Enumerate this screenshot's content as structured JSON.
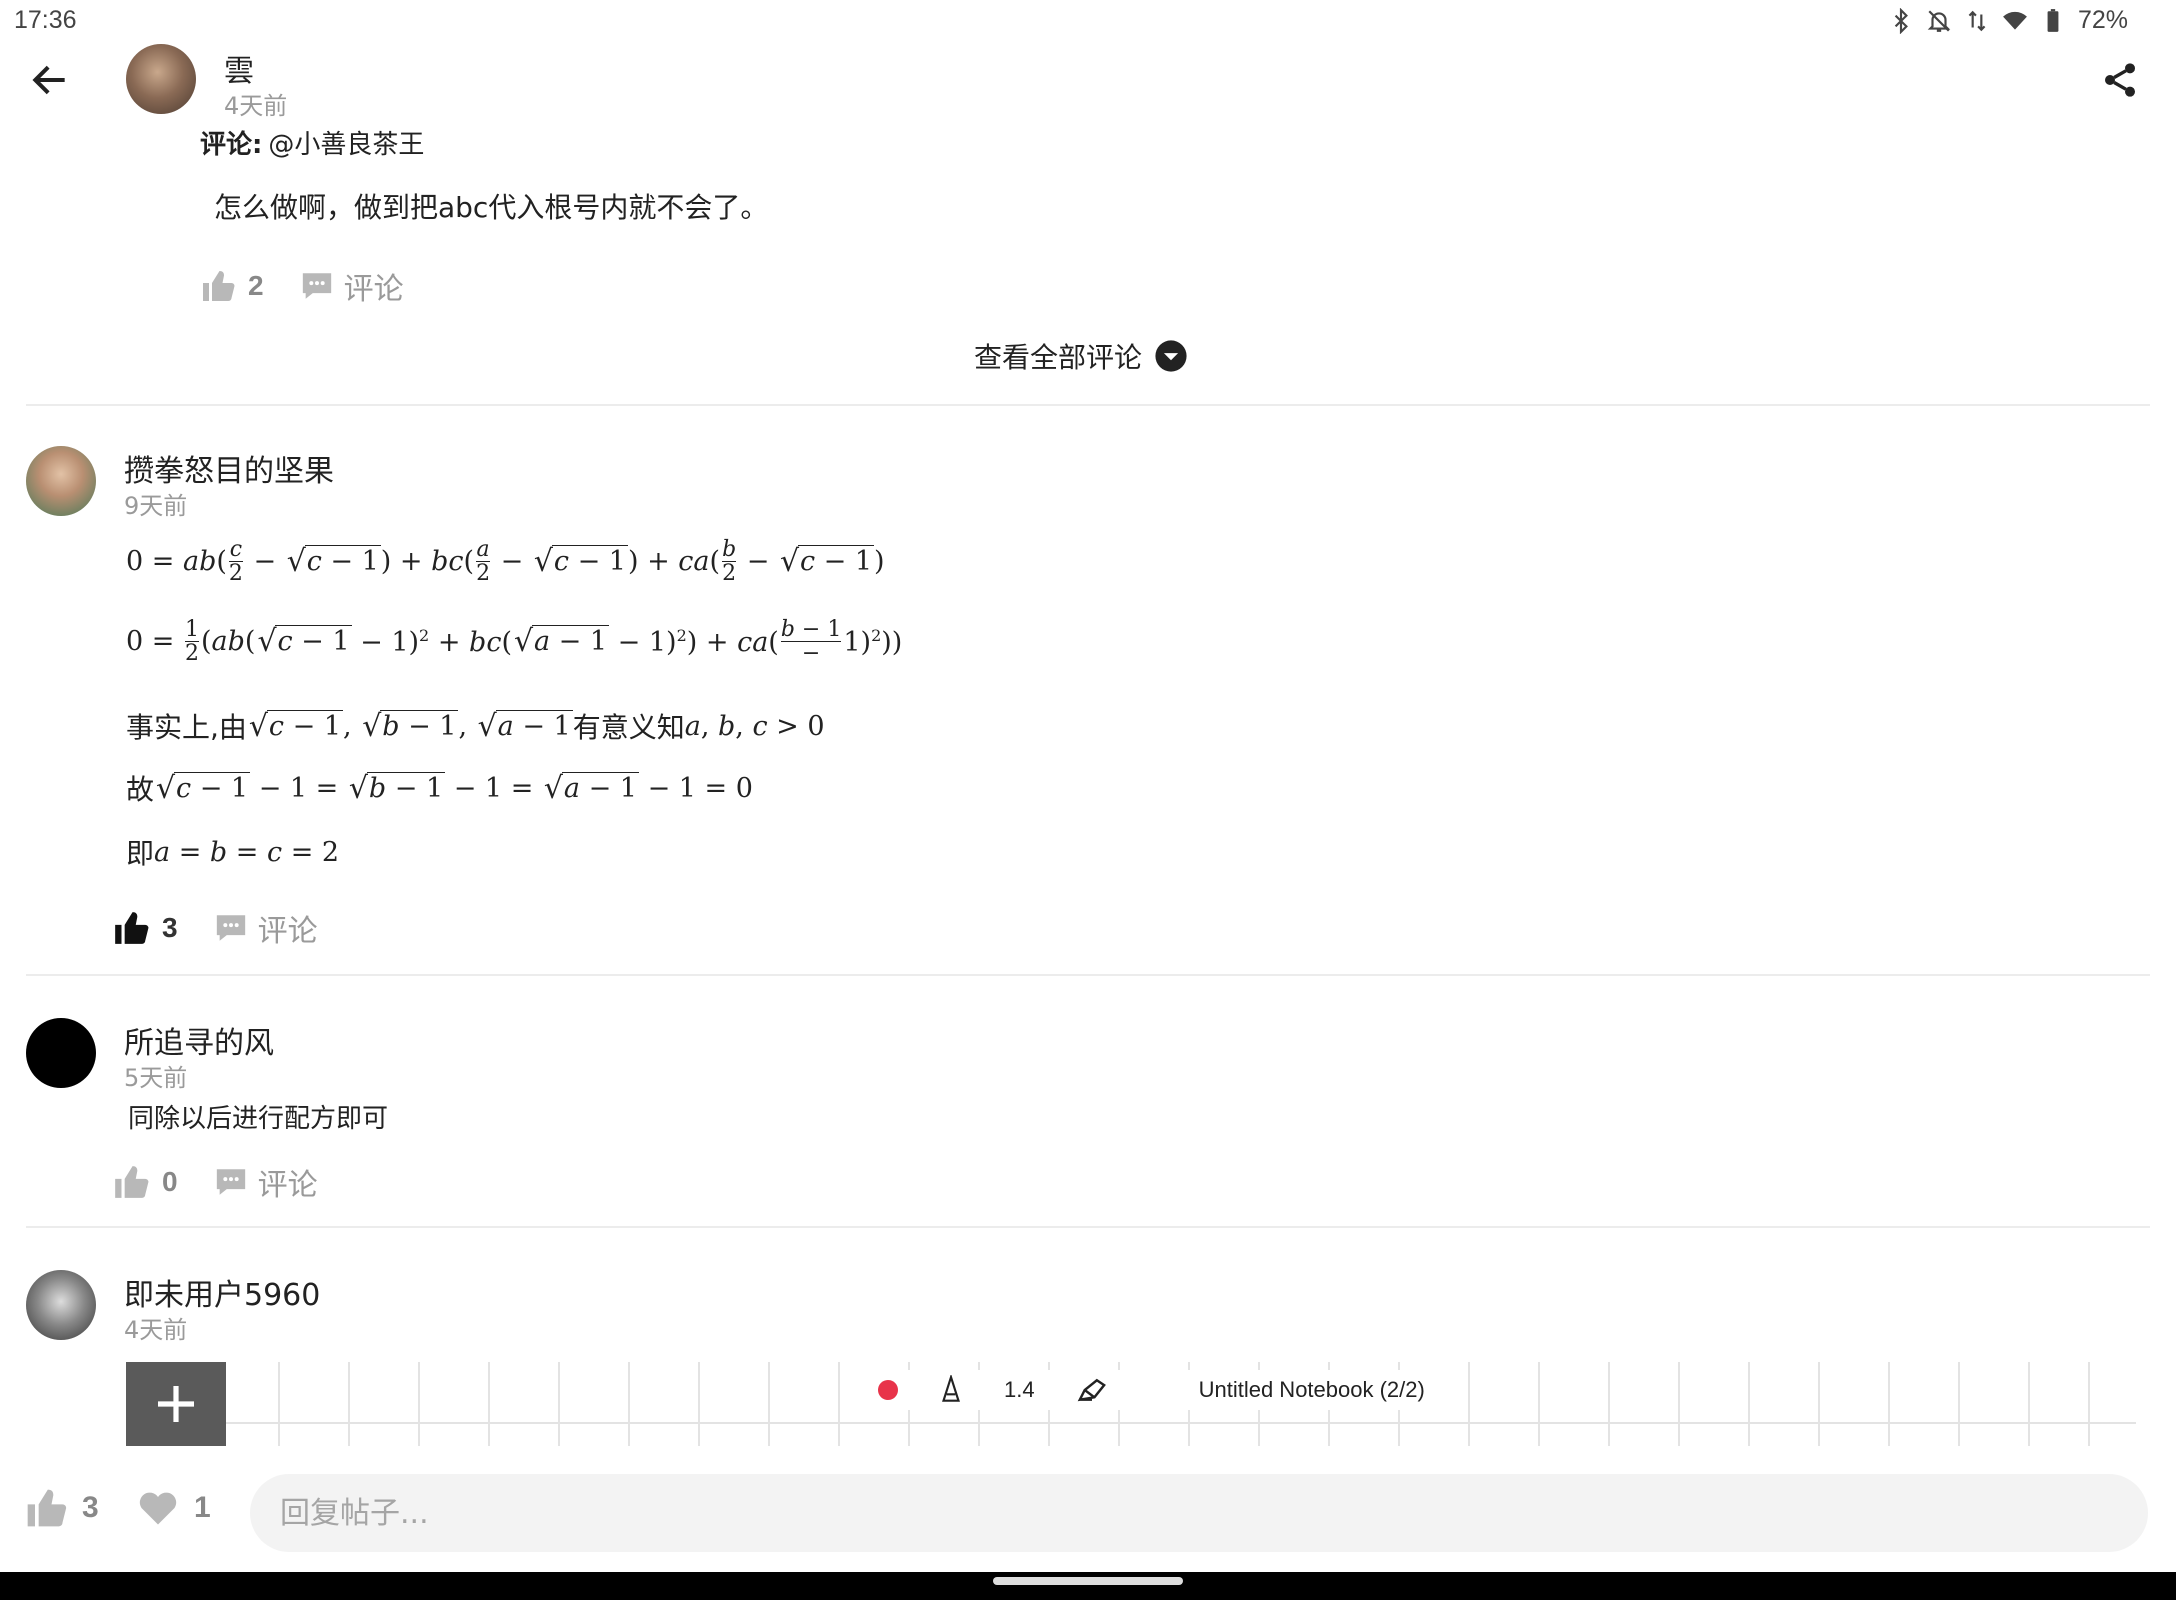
{
  "status_bar": {
    "time": "17:36",
    "battery": "72%"
  },
  "header": {
    "author": "雲",
    "time": "4天前"
  },
  "top_comment": {
    "reply_label": "评论:",
    "reply_to": "@小善良茶王",
    "text": "怎么做啊，做到把abc代入根号内就不会了。",
    "likes": "2",
    "comment_label": "评论"
  },
  "view_all": "查看全部评论",
  "comments": [
    {
      "author": "攒拳怒目的坚果",
      "time": "9天前",
      "likes": "3",
      "comment_label": "评论",
      "math_lines": {
        "line3_prefix": "事实上,",
        "line3_by": "由",
        "line3_meaning": "有意义知",
        "line4_prefix": "故",
        "line5_prefix": "即"
      }
    },
    {
      "author": "所追寻的风",
      "time": "5天前",
      "text": "同除以后进行配方即可",
      "likes": "0",
      "comment_label": "评论"
    },
    {
      "author": "即未用户5960",
      "time": "4天前"
    }
  ],
  "notebook": {
    "zoom": "1.4",
    "title": "Untitled Notebook (2/2)"
  },
  "bottom_bar": {
    "likes": "3",
    "hearts": "1",
    "reply_placeholder": "回复帖子..."
  },
  "colors": {
    "accent_record": "#e8334a",
    "muted_text": "#9a9a9a",
    "divider": "#ececec"
  }
}
